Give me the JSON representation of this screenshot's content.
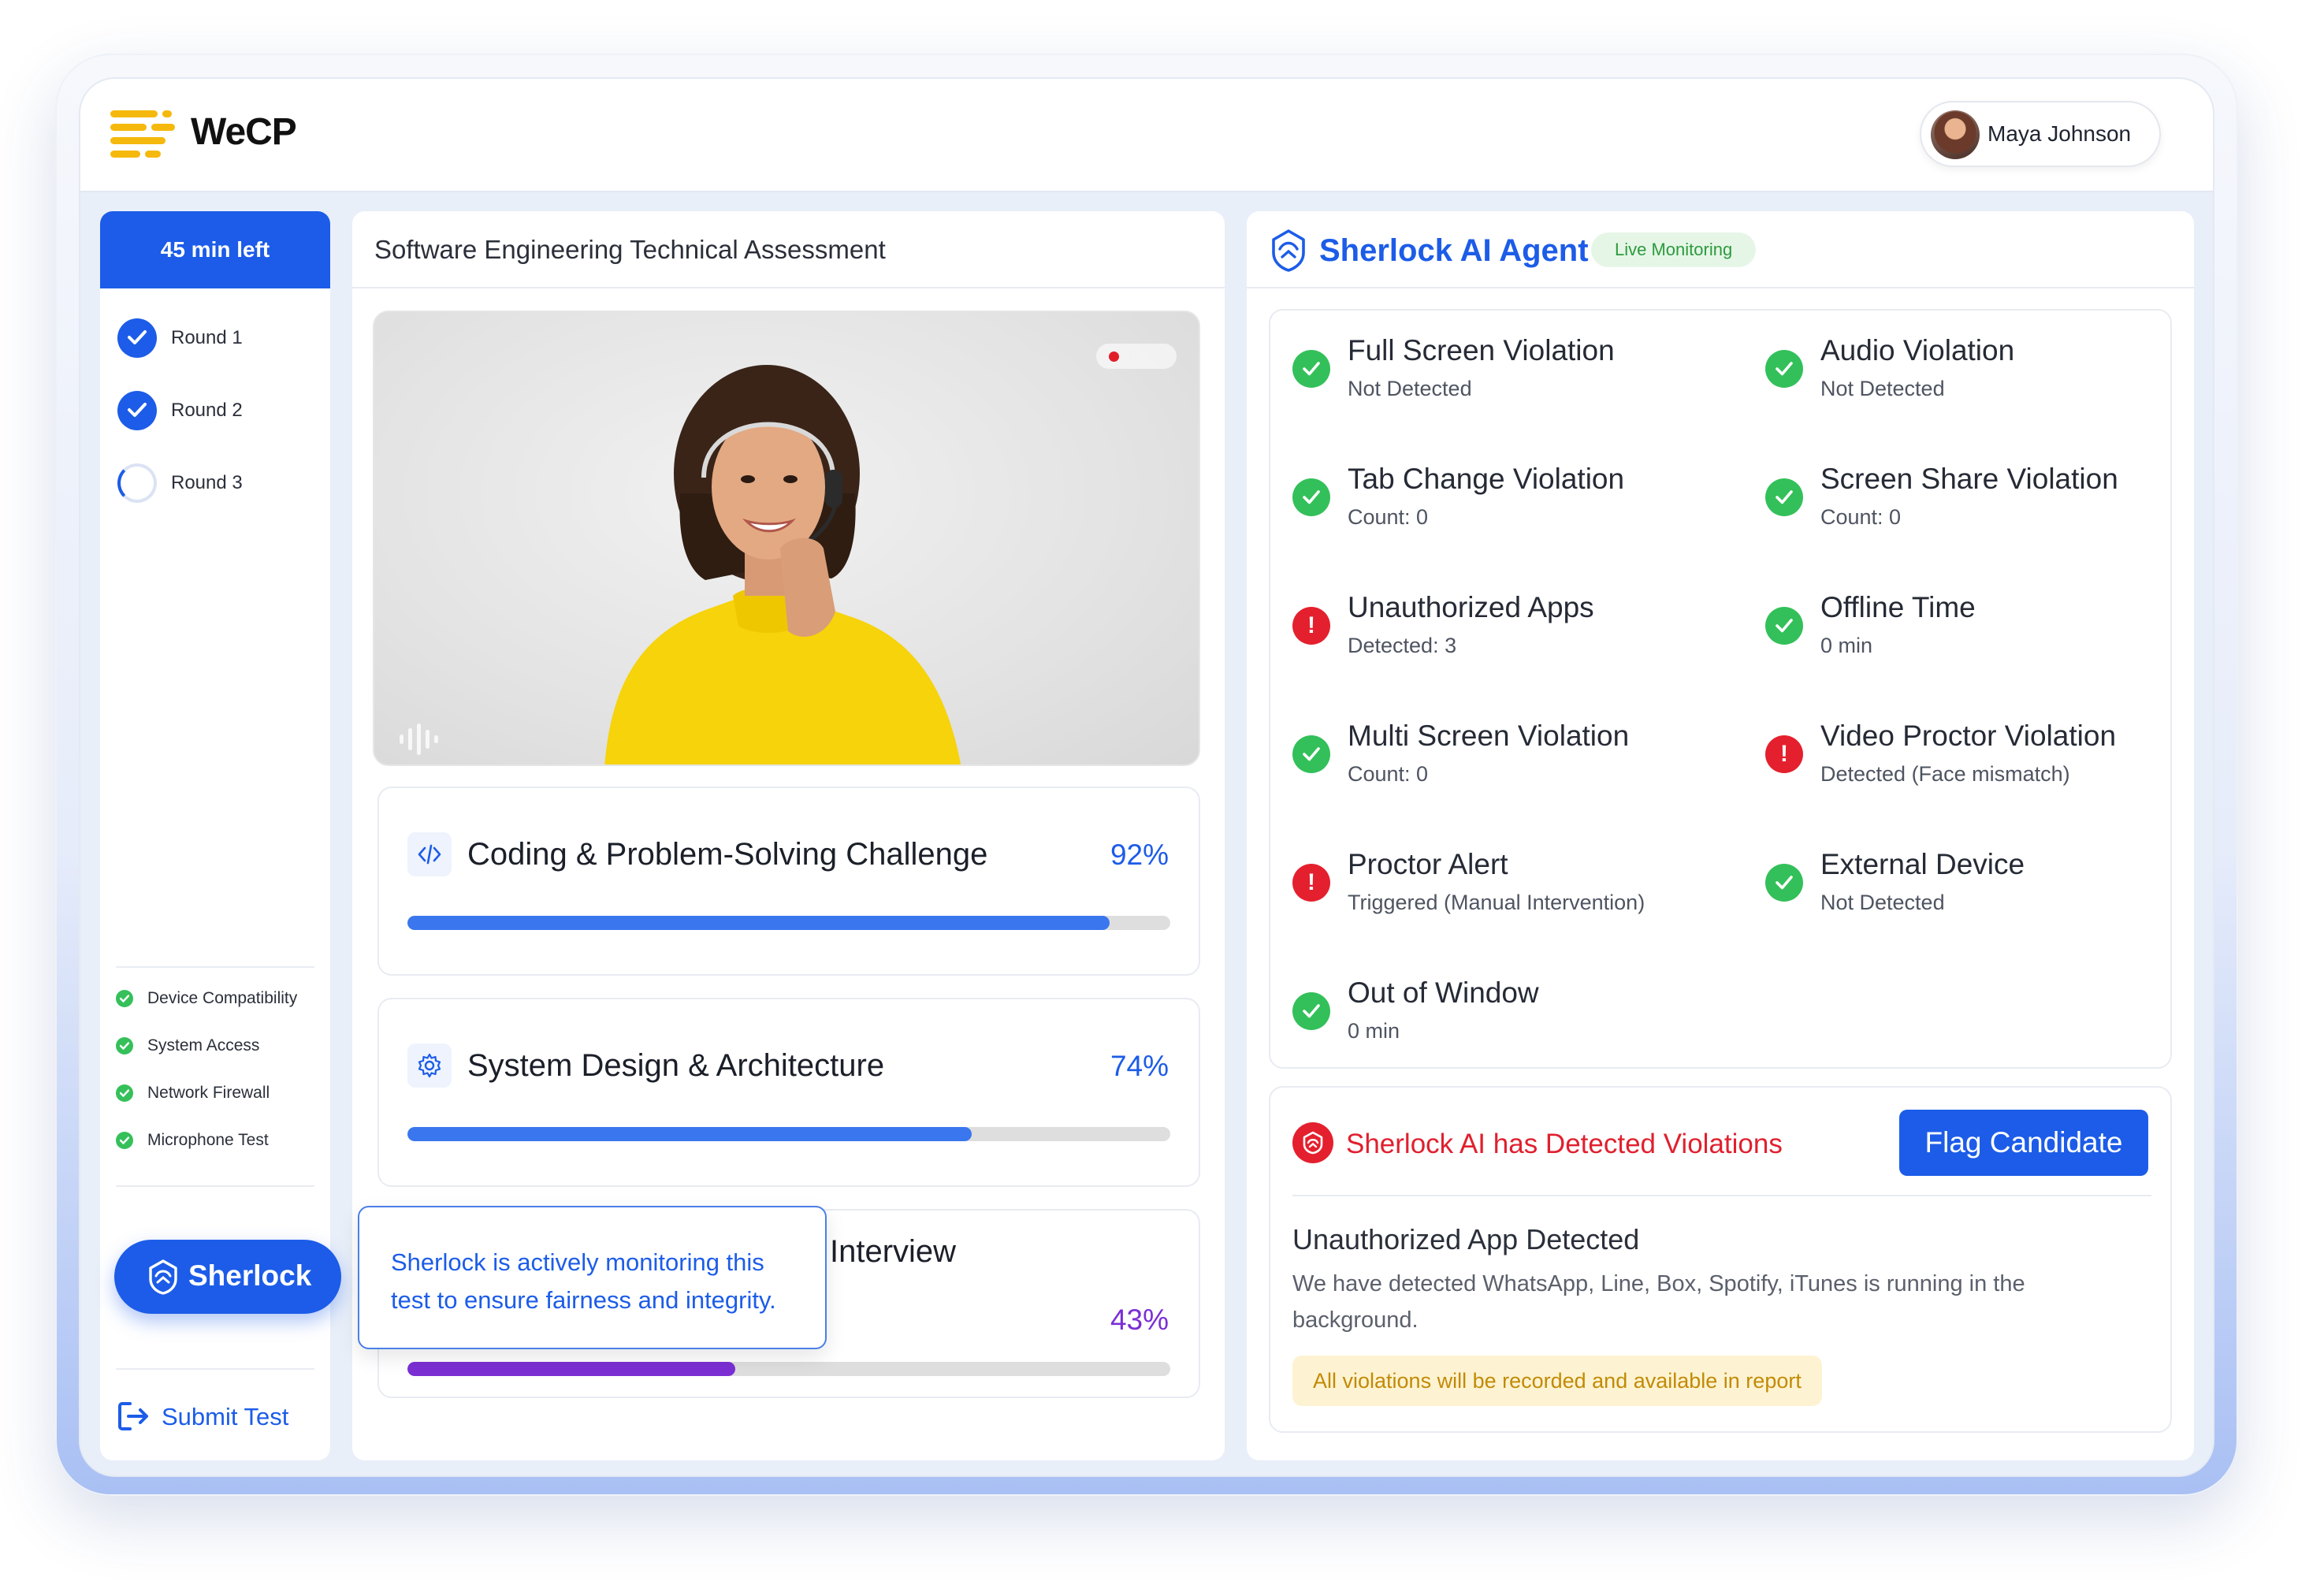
{
  "brand": {
    "name": "WeCP"
  },
  "user": {
    "name": "Maya Johnson"
  },
  "sidebar": {
    "timer": "45 min left",
    "rounds": [
      {
        "label": "Round 1",
        "status": "done"
      },
      {
        "label": "Round 2",
        "status": "done"
      },
      {
        "label": "Round 3",
        "status": "in-progress"
      }
    ],
    "checks": [
      "Device Compatibility",
      "System Access",
      "Network Firewall",
      "Microphone Test"
    ],
    "sherlock_button": "Sherlock",
    "submit": "Submit Test"
  },
  "assessment": {
    "title": "Software Engineering Technical Assessment",
    "video": {
      "rec_label": "REC"
    },
    "skills": [
      {
        "name": "Coding & Problem-Solving Challenge",
        "percent_label": "92%",
        "progress": 0.92,
        "icon": "code-icon",
        "color": "#3a76ee"
      },
      {
        "name": "System Design & Architecture",
        "percent_label": "74%",
        "progress": 0.74,
        "icon": "gear-icon",
        "color": "#3a76ee"
      },
      {
        "name": "Interview",
        "percent_label": "43%",
        "progress": 0.43,
        "icon": "",
        "color": "#7b2fd4"
      }
    ],
    "tooltip": "Sherlock is actively monitoring this test to ensure fairness and integrity."
  },
  "agent": {
    "title": "Sherlock AI Agent",
    "badge": "Live Monitoring",
    "violations": [
      {
        "title": "Full Screen Violation",
        "status_text": "Not Detected",
        "ok": true
      },
      {
        "title": "Audio Violation",
        "status_text": "Not Detected",
        "ok": true
      },
      {
        "title": "Tab Change Violation",
        "status_text": "Count: 0",
        "ok": true
      },
      {
        "title": "Screen Share Violation",
        "status_text": "Count: 0",
        "ok": true
      },
      {
        "title": "Unauthorized Apps",
        "status_text": "Detected: 3",
        "ok": false
      },
      {
        "title": "Offline Time",
        "status_text": "0 min",
        "ok": true
      },
      {
        "title": "Multi Screen Violation",
        "status_text": "Count: 0",
        "ok": true
      },
      {
        "title": "Video Proctor Violation",
        "status_text": "Detected (Face mismatch)",
        "ok": false
      },
      {
        "title": "Proctor Alert",
        "status_text": "Triggered (Manual Intervention)",
        "ok": false
      },
      {
        "title": "External Device",
        "status_text": "Not Detected",
        "ok": true
      },
      {
        "title": "Out of Window",
        "status_text": "0 min",
        "ok": true
      }
    ],
    "alert": {
      "title": "Sherlock AI has Detected Violations",
      "flag_button": "Flag Candidate",
      "heading": "Unauthorized App Detected",
      "description": "We have detected WhatsApp, Line, Box, Spotify, iTunes is running in the background.",
      "note": "All violations will be recorded and available in report"
    }
  },
  "colors": {
    "accent": "#1c5ce8",
    "success": "#33c05a",
    "danger": "#e4202e",
    "warning_bg": "#fdf3d2"
  }
}
